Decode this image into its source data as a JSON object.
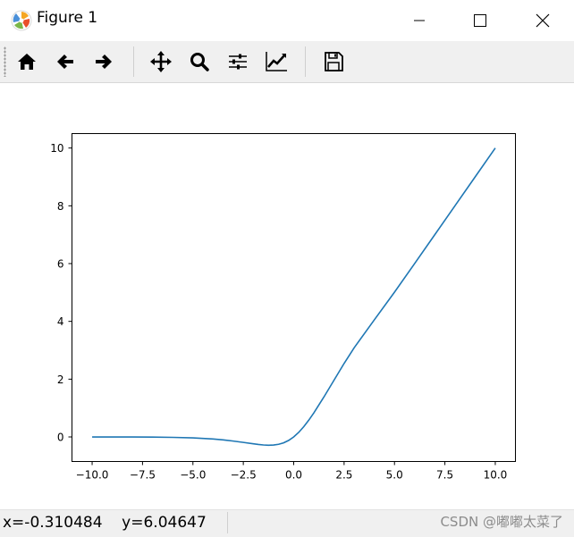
{
  "window": {
    "title": "Figure 1",
    "icon": "matplotlib-logo-icon",
    "controls": [
      "minimize-icon",
      "maximize-icon",
      "close-icon"
    ]
  },
  "toolbar": {
    "buttons": [
      {
        "name": "home",
        "icon": "home-icon"
      },
      {
        "name": "back",
        "icon": "arrow-left-icon"
      },
      {
        "name": "forward",
        "icon": "arrow-right-icon"
      },
      {
        "name": "pan",
        "icon": "move-icon"
      },
      {
        "name": "zoom",
        "icon": "magnifier-icon"
      },
      {
        "name": "configure-subplots",
        "icon": "sliders-icon"
      },
      {
        "name": "edit-axis",
        "icon": "chart-line-icon"
      },
      {
        "name": "save",
        "icon": "floppy-disk-icon"
      }
    ]
  },
  "status": {
    "coords": "x=-0.310484    y=6.04647",
    "watermark": "CSDN @嘟嘟太菜了"
  },
  "chart_data": {
    "type": "line",
    "title": "",
    "xlabel": "",
    "ylabel": "",
    "xlim": [
      -11,
      11
    ],
    "ylim": [
      -0.85,
      10.5
    ],
    "xticks": [
      -10.0,
      -7.5,
      -5.0,
      -2.5,
      0.0,
      2.5,
      5.0,
      7.5,
      10.0
    ],
    "xtick_labels": [
      "−10.0",
      "−7.5",
      "−5.0",
      "−2.5",
      "0.0",
      "2.5",
      "5.0",
      "7.5",
      "10.0"
    ],
    "yticks": [
      0,
      2,
      4,
      6,
      8,
      10
    ],
    "ytick_labels": [
      "0",
      "2",
      "4",
      "6",
      "8",
      "10"
    ],
    "grid": false,
    "line_color": "#1f77b4",
    "series": [
      {
        "x": [
          -10,
          -9,
          -8,
          -7,
          -6,
          -5,
          -4,
          -3.5,
          -3,
          -2.5,
          -2,
          -1.75,
          -1.5,
          -1.25,
          -1,
          -0.75,
          -0.5,
          -0.25,
          0,
          0.25,
          0.5,
          0.75,
          1,
          1.5,
          2,
          2.5,
          3,
          4,
          5,
          6,
          7,
          8,
          9,
          10
        ],
        "y": [
          -0.0005,
          -0.001,
          -0.003,
          -0.006,
          -0.015,
          -0.033,
          -0.072,
          -0.102,
          -0.142,
          -0.189,
          -0.238,
          -0.261,
          -0.278,
          -0.287,
          -0.281,
          -0.255,
          -0.203,
          -0.12,
          0.0,
          0.159,
          0.356,
          0.583,
          0.834,
          1.385,
          1.965,
          2.544,
          3.088,
          4.053,
          5.01,
          6.003,
          7.001,
          8.0,
          9.0,
          10.0
        ]
      }
    ]
  }
}
